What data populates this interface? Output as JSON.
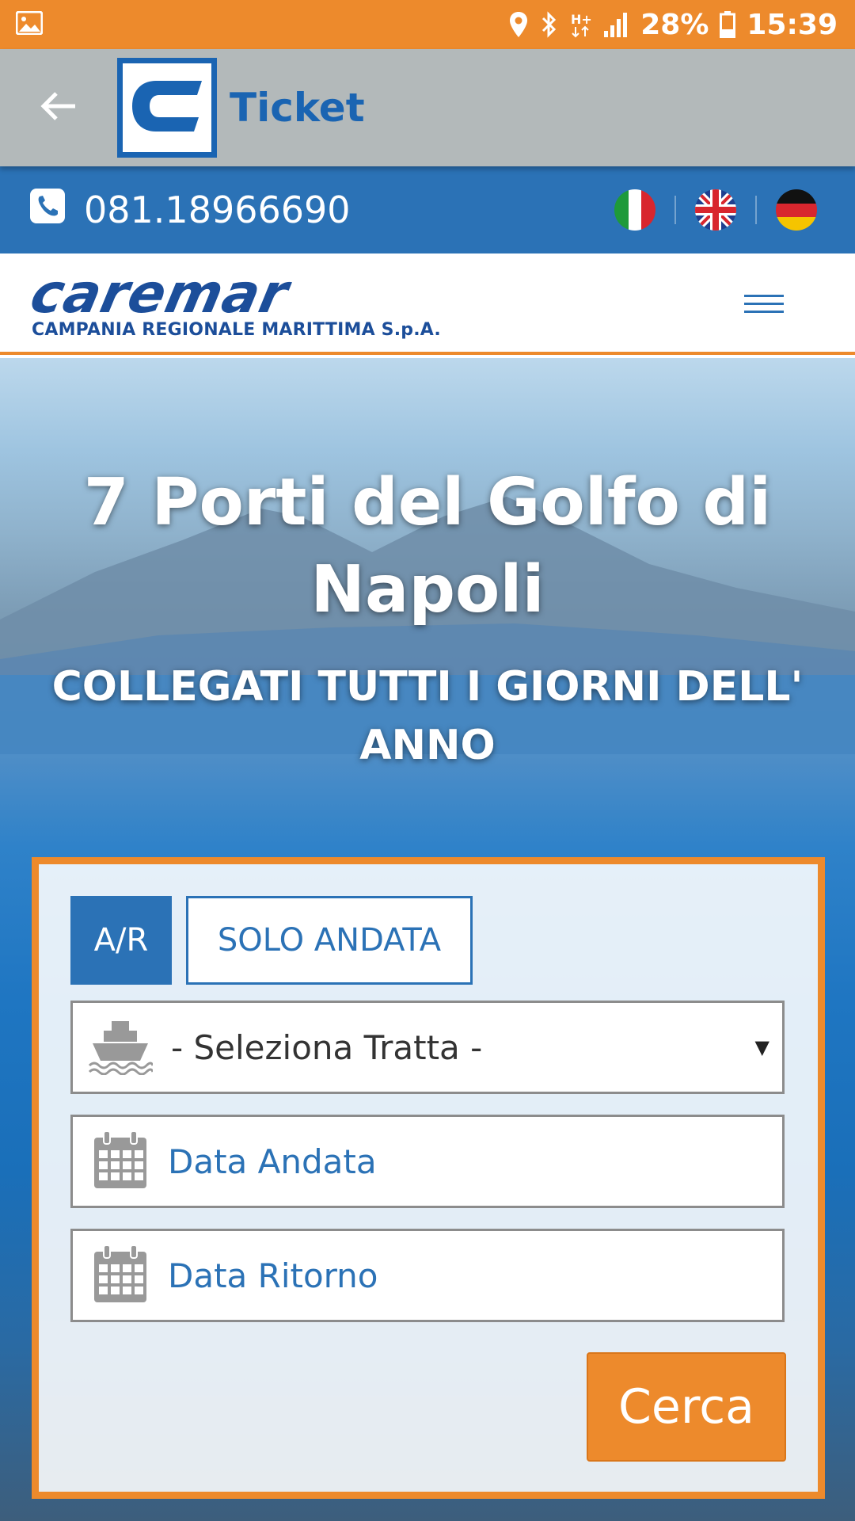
{
  "status_bar": {
    "battery": "28%",
    "time": "15:39",
    "icons": [
      "image-icon",
      "location-icon",
      "bluetooth-icon",
      "network-hplus-icon",
      "signal-icon",
      "battery-icon"
    ]
  },
  "app_bar": {
    "title": "Ticket",
    "back_icon": "arrow-left-icon",
    "logo_icon": "caremar-c-logo-icon"
  },
  "contact": {
    "phone": "081.18966690",
    "phone_icon": "phone-icon",
    "languages": [
      {
        "code": "it",
        "icon": "flag-italy-icon"
      },
      {
        "code": "en",
        "icon": "flag-uk-icon"
      },
      {
        "code": "de",
        "icon": "flag-germany-icon"
      }
    ]
  },
  "brand": {
    "wordmark": "caremar",
    "subtitle": "CAMPANIA REGIONALE MARITTIMA S.p.A.",
    "menu_icon": "hamburger-menu-icon"
  },
  "hero": {
    "title": "7 Porti del Golfo di Napoli",
    "subtitle": "COLLEGATI TUTTI I GIORNI DELL' ANNO"
  },
  "booking": {
    "tabs": [
      {
        "label": "A/R",
        "active": true
      },
      {
        "label": "SOLO ANDATA",
        "active": false
      }
    ],
    "route_select": {
      "value": "- Seleziona Tratta -",
      "icon": "ship-icon"
    },
    "departure_date": {
      "placeholder": "Data Andata",
      "icon": "calendar-icon"
    },
    "return_date": {
      "placeholder": "Data Ritorno",
      "icon": "calendar-icon"
    },
    "search_label": "Cerca"
  },
  "colors": {
    "accent_orange": "#ed8a2c",
    "brand_blue": "#2b72b6",
    "app_bar_gray": "#b3b9ba"
  }
}
